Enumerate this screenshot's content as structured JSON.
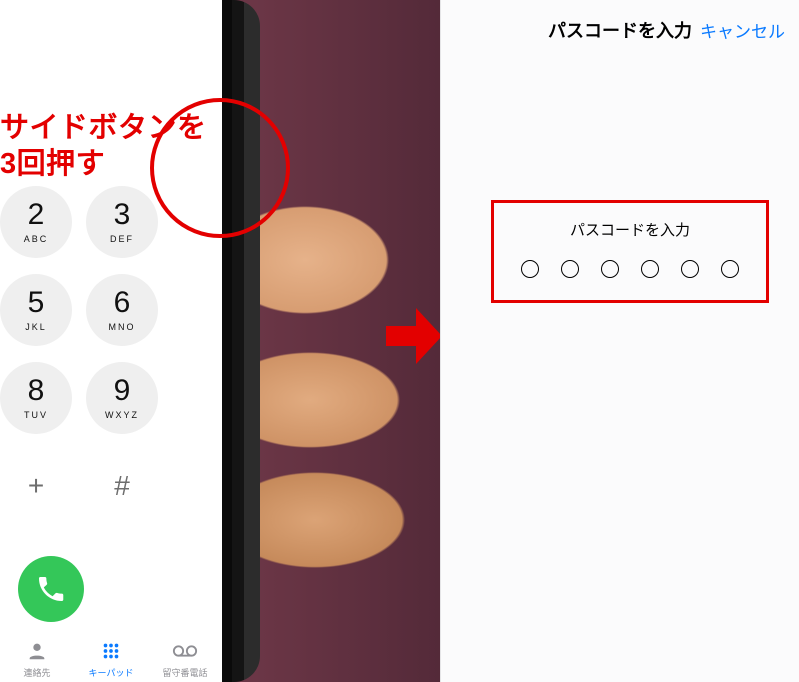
{
  "caption": "サイドボタンを\n3回押す",
  "keypad": {
    "rows": [
      [
        {
          "n": "2",
          "l": "ABC"
        },
        {
          "n": "3",
          "l": "DEF"
        }
      ],
      [
        {
          "n": "5",
          "l": "JKL"
        },
        {
          "n": "6",
          "l": "MNO"
        }
      ],
      [
        {
          "n": "8",
          "l": "TUV"
        },
        {
          "n": "9",
          "l": "WXYZ"
        }
      ],
      [
        {
          "n": "+",
          "l": ""
        },
        {
          "n": "#",
          "l": ""
        }
      ]
    ]
  },
  "tabs": {
    "contacts": "連絡先",
    "keypad": "キーパッド",
    "voicemail": "留守番電話"
  },
  "passcode": {
    "title": "パスコードを入力",
    "cancel": "キャンセル",
    "prompt": "パスコードを入力"
  }
}
